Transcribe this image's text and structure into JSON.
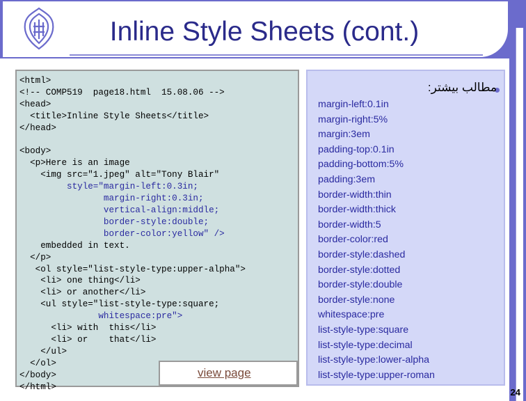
{
  "slide": {
    "title": "Inline Style Sheets (cont.)",
    "page_number": "24"
  },
  "code": {
    "lines": [
      "<html>",
      "<!-- COMP519  page18.html  15.08.06 -->",
      "<head>",
      "  <title>Inline Style Sheets</title>",
      "</head>",
      "",
      "<body>",
      "  <p>Here is an image",
      "    <img src=\"1.jpeg\" alt=\"Tony Blair\"",
      "         style=\"margin-left:0.3in;",
      "                margin-right:0.3in;",
      "                vertical-align:middle;",
      "                border-style:double;",
      "                border-color:yellow\" />",
      "    embedded in text.",
      "  </p>",
      "   <ol style=\"list-style-type:upper-alpha\">",
      "    <li> one thing</li>",
      "    <li> or another</li>",
      "    <ul style=\"list-style-type:square;",
      "               whitespace:pre\">",
      "      <li> with  this</li>",
      "      <li> or    that</li>",
      "    </ul>",
      "  </ol>",
      "</body>",
      "</html>"
    ]
  },
  "view_link": {
    "label": "view page"
  },
  "properties": {
    "heading": "مطالب بیشتر:",
    "items": [
      "margin-left:0.1in",
      "margin-right:5%",
      "margin:3em",
      "padding-top:0.1in",
      "padding-bottom:5%",
      "padding:3em",
      "border-width:thin",
      "border-width:thick",
      "border-width:5",
      "border-color:red",
      "border-style:dashed",
      "border-style:dotted",
      "border-style:double",
      "border-style:none",
      "whitespace:pre",
      "list-style-type:square",
      "list-style-type:decimal",
      "list-style-type:lower-alpha",
      "list-style-type:upper-roman"
    ]
  },
  "colors": {
    "frame": "#6b6bcc",
    "title_text": "#2a2a8a",
    "code_panel": "#cfe0e0",
    "props_panel": "#d4d8f8",
    "accent_text": "#2a2aa0"
  },
  "icons": {
    "logo": "university-emblem-icon",
    "bullet": "bullet-dot-icon"
  }
}
